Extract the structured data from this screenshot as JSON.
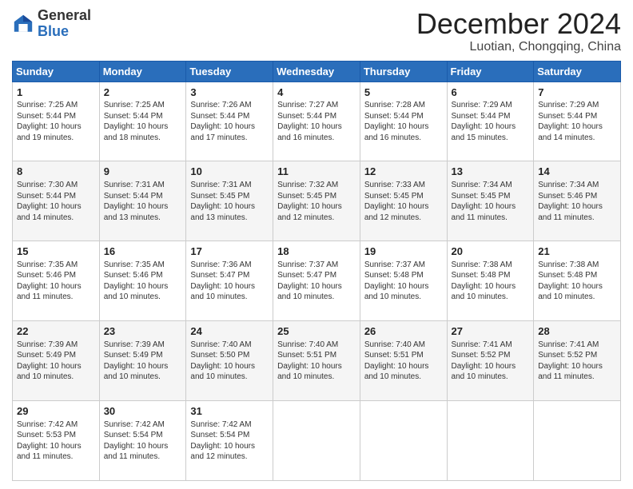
{
  "logo": {
    "general": "General",
    "blue": "Blue"
  },
  "header": {
    "month": "December 2024",
    "location": "Luotian, Chongqing, China"
  },
  "weekdays": [
    "Sunday",
    "Monday",
    "Tuesday",
    "Wednesday",
    "Thursday",
    "Friday",
    "Saturday"
  ],
  "weeks": [
    [
      {
        "day": "1",
        "info": "Sunrise: 7:25 AM\nSunset: 5:44 PM\nDaylight: 10 hours\nand 19 minutes."
      },
      {
        "day": "2",
        "info": "Sunrise: 7:25 AM\nSunset: 5:44 PM\nDaylight: 10 hours\nand 18 minutes."
      },
      {
        "day": "3",
        "info": "Sunrise: 7:26 AM\nSunset: 5:44 PM\nDaylight: 10 hours\nand 17 minutes."
      },
      {
        "day": "4",
        "info": "Sunrise: 7:27 AM\nSunset: 5:44 PM\nDaylight: 10 hours\nand 16 minutes."
      },
      {
        "day": "5",
        "info": "Sunrise: 7:28 AM\nSunset: 5:44 PM\nDaylight: 10 hours\nand 16 minutes."
      },
      {
        "day": "6",
        "info": "Sunrise: 7:29 AM\nSunset: 5:44 PM\nDaylight: 10 hours\nand 15 minutes."
      },
      {
        "day": "7",
        "info": "Sunrise: 7:29 AM\nSunset: 5:44 PM\nDaylight: 10 hours\nand 14 minutes."
      }
    ],
    [
      {
        "day": "8",
        "info": "Sunrise: 7:30 AM\nSunset: 5:44 PM\nDaylight: 10 hours\nand 14 minutes."
      },
      {
        "day": "9",
        "info": "Sunrise: 7:31 AM\nSunset: 5:44 PM\nDaylight: 10 hours\nand 13 minutes."
      },
      {
        "day": "10",
        "info": "Sunrise: 7:31 AM\nSunset: 5:45 PM\nDaylight: 10 hours\nand 13 minutes."
      },
      {
        "day": "11",
        "info": "Sunrise: 7:32 AM\nSunset: 5:45 PM\nDaylight: 10 hours\nand 12 minutes."
      },
      {
        "day": "12",
        "info": "Sunrise: 7:33 AM\nSunset: 5:45 PM\nDaylight: 10 hours\nand 12 minutes."
      },
      {
        "day": "13",
        "info": "Sunrise: 7:34 AM\nSunset: 5:45 PM\nDaylight: 10 hours\nand 11 minutes."
      },
      {
        "day": "14",
        "info": "Sunrise: 7:34 AM\nSunset: 5:46 PM\nDaylight: 10 hours\nand 11 minutes."
      }
    ],
    [
      {
        "day": "15",
        "info": "Sunrise: 7:35 AM\nSunset: 5:46 PM\nDaylight: 10 hours\nand 11 minutes."
      },
      {
        "day": "16",
        "info": "Sunrise: 7:35 AM\nSunset: 5:46 PM\nDaylight: 10 hours\nand 10 minutes."
      },
      {
        "day": "17",
        "info": "Sunrise: 7:36 AM\nSunset: 5:47 PM\nDaylight: 10 hours\nand 10 minutes."
      },
      {
        "day": "18",
        "info": "Sunrise: 7:37 AM\nSunset: 5:47 PM\nDaylight: 10 hours\nand 10 minutes."
      },
      {
        "day": "19",
        "info": "Sunrise: 7:37 AM\nSunset: 5:48 PM\nDaylight: 10 hours\nand 10 minutes."
      },
      {
        "day": "20",
        "info": "Sunrise: 7:38 AM\nSunset: 5:48 PM\nDaylight: 10 hours\nand 10 minutes."
      },
      {
        "day": "21",
        "info": "Sunrise: 7:38 AM\nSunset: 5:48 PM\nDaylight: 10 hours\nand 10 minutes."
      }
    ],
    [
      {
        "day": "22",
        "info": "Sunrise: 7:39 AM\nSunset: 5:49 PM\nDaylight: 10 hours\nand 10 minutes."
      },
      {
        "day": "23",
        "info": "Sunrise: 7:39 AM\nSunset: 5:49 PM\nDaylight: 10 hours\nand 10 minutes."
      },
      {
        "day": "24",
        "info": "Sunrise: 7:40 AM\nSunset: 5:50 PM\nDaylight: 10 hours\nand 10 minutes."
      },
      {
        "day": "25",
        "info": "Sunrise: 7:40 AM\nSunset: 5:51 PM\nDaylight: 10 hours\nand 10 minutes."
      },
      {
        "day": "26",
        "info": "Sunrise: 7:40 AM\nSunset: 5:51 PM\nDaylight: 10 hours\nand 10 minutes."
      },
      {
        "day": "27",
        "info": "Sunrise: 7:41 AM\nSunset: 5:52 PM\nDaylight: 10 hours\nand 10 minutes."
      },
      {
        "day": "28",
        "info": "Sunrise: 7:41 AM\nSunset: 5:52 PM\nDaylight: 10 hours\nand 11 minutes."
      }
    ],
    [
      {
        "day": "29",
        "info": "Sunrise: 7:42 AM\nSunset: 5:53 PM\nDaylight: 10 hours\nand 11 minutes."
      },
      {
        "day": "30",
        "info": "Sunrise: 7:42 AM\nSunset: 5:54 PM\nDaylight: 10 hours\nand 11 minutes."
      },
      {
        "day": "31",
        "info": "Sunrise: 7:42 AM\nSunset: 5:54 PM\nDaylight: 10 hours\nand 12 minutes."
      },
      null,
      null,
      null,
      null
    ]
  ]
}
